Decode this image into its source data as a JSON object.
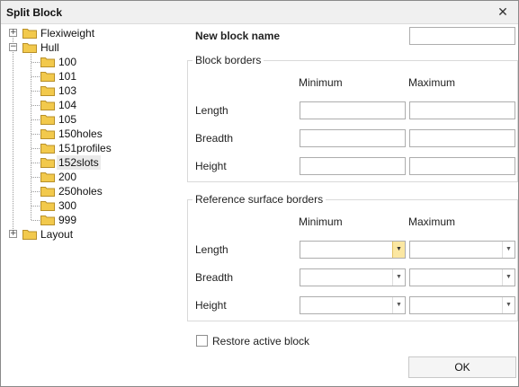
{
  "window": {
    "title": "Split Block",
    "close_glyph": "✕"
  },
  "tree": {
    "roots": [
      {
        "label": "Flexiweight",
        "expander": "+"
      },
      {
        "label": "Hull",
        "expander": "−"
      },
      {
        "label": "Layout",
        "expander": "+"
      }
    ],
    "hull_children": [
      "100",
      "101",
      "103",
      "104",
      "105",
      "150holes",
      "151profiles",
      "152slots",
      "200",
      "250holes",
      "300",
      "999"
    ],
    "selected": "152slots"
  },
  "form": {
    "new_block_name_label": "New block name",
    "new_block_name_value": "",
    "block_borders": {
      "title": "Block borders",
      "min_header": "Minimum",
      "max_header": "Maximum",
      "rows": [
        "Length",
        "Breadth",
        "Height"
      ]
    },
    "reference_surface_borders": {
      "title": "Reference surface borders",
      "min_header": "Minimum",
      "max_header": "Maximum",
      "rows": [
        "Length",
        "Breadth",
        "Height"
      ],
      "combo_arrow": "▼"
    },
    "restore_active_block_label": "Restore active block",
    "restore_active_block_checked": false,
    "ok_label": "OK"
  },
  "colors": {
    "folder_fill": "#f2c94c",
    "folder_edge": "#b8902a",
    "combo_highlight": "#fbe7a2"
  }
}
